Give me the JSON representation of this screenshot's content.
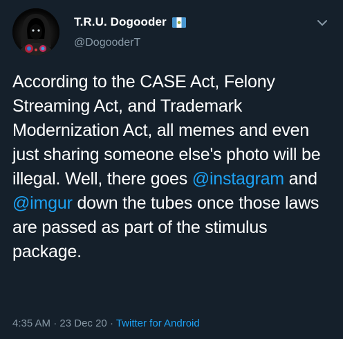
{
  "user": {
    "display_name": "T.R.U. Dogooder",
    "handle": "@DogooderT",
    "flag_icon": "guatemala-flag-icon",
    "avatar_icon": "hooded-figure-avatar"
  },
  "tweet": {
    "text_parts": [
      "According to the CASE Act, Felony Streaming Act, and Trademark Modernization Act, all memes and even just sharing someone else's photo will be illegal. Well, there goes ",
      "@instagram",
      " and ",
      "@imgur",
      " down the tubes once those laws are passed as part of the stimulus package."
    ],
    "time": "4:35 AM",
    "separator": " · ",
    "date": "23 Dec 20",
    "source": "Twitter for Android"
  },
  "menu": {
    "icon": "chevron-down-icon"
  },
  "colors": {
    "background": "#15202b",
    "text": "#ffffff",
    "secondary": "#8899a6",
    "accent": "#1da1f2"
  }
}
